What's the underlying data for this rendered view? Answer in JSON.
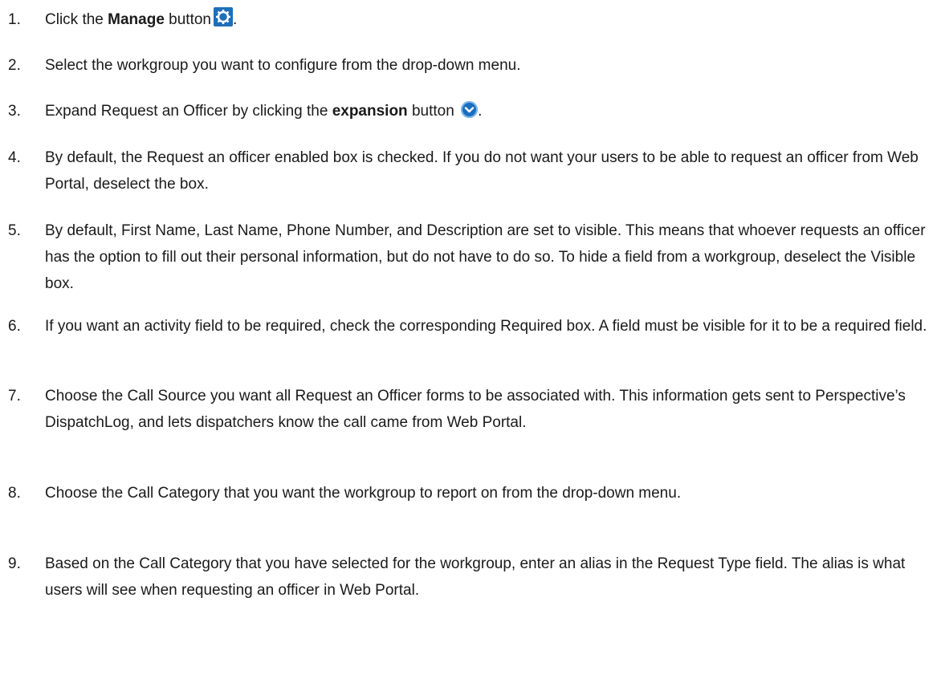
{
  "steps": [
    {
      "num": "1.",
      "parts": [
        "Click the ",
        "Manage",
        " button",
        "."
      ]
    },
    {
      "num": "2.",
      "text": "Select the workgroup you want to configure from the drop-down menu."
    },
    {
      "num": "3.",
      "parts": [
        "Expand Request an Officer by clicking the ",
        "expansion",
        " button ",
        "."
      ]
    },
    {
      "num": "4.",
      "text": "By default, the Request an officer enabled box is checked. If you do not want your users to be able to request an officer from Web Portal, deselect the box."
    },
    {
      "num": "5.",
      "text": "By default, First Name, Last Name, Phone Number, and Description are set to visible. This means that whoever requests an officer has the option to fill out their personal information, but do not have to do so. To hide a field from a workgroup, deselect the Visible box."
    },
    {
      "num": "6.",
      "text": "If you want an activity field to be required, check the corresponding Required box. A field must be visible for it to be a required field."
    },
    {
      "num": "7.",
      "text": "Choose the Call Source you want all Request an Officer forms to be associated with. This information gets sent to Perspective’s DispatchLog, and lets dispatchers know the call came from Web Portal."
    },
    {
      "num": "8.",
      "text": "Choose the Call Category that you want the workgroup to report on from the drop-down menu."
    },
    {
      "num": "9.",
      "text": "Based on the Call Category that you have selected for the workgroup, enter an alias in the Request Type field. The alias is what users will see when requesting an officer in Web Portal."
    }
  ],
  "icons": {
    "manage": "gear-icon",
    "expansion": "chevron-down-circle-icon"
  },
  "colors": {
    "icon_blue": "#1f6fb8"
  }
}
